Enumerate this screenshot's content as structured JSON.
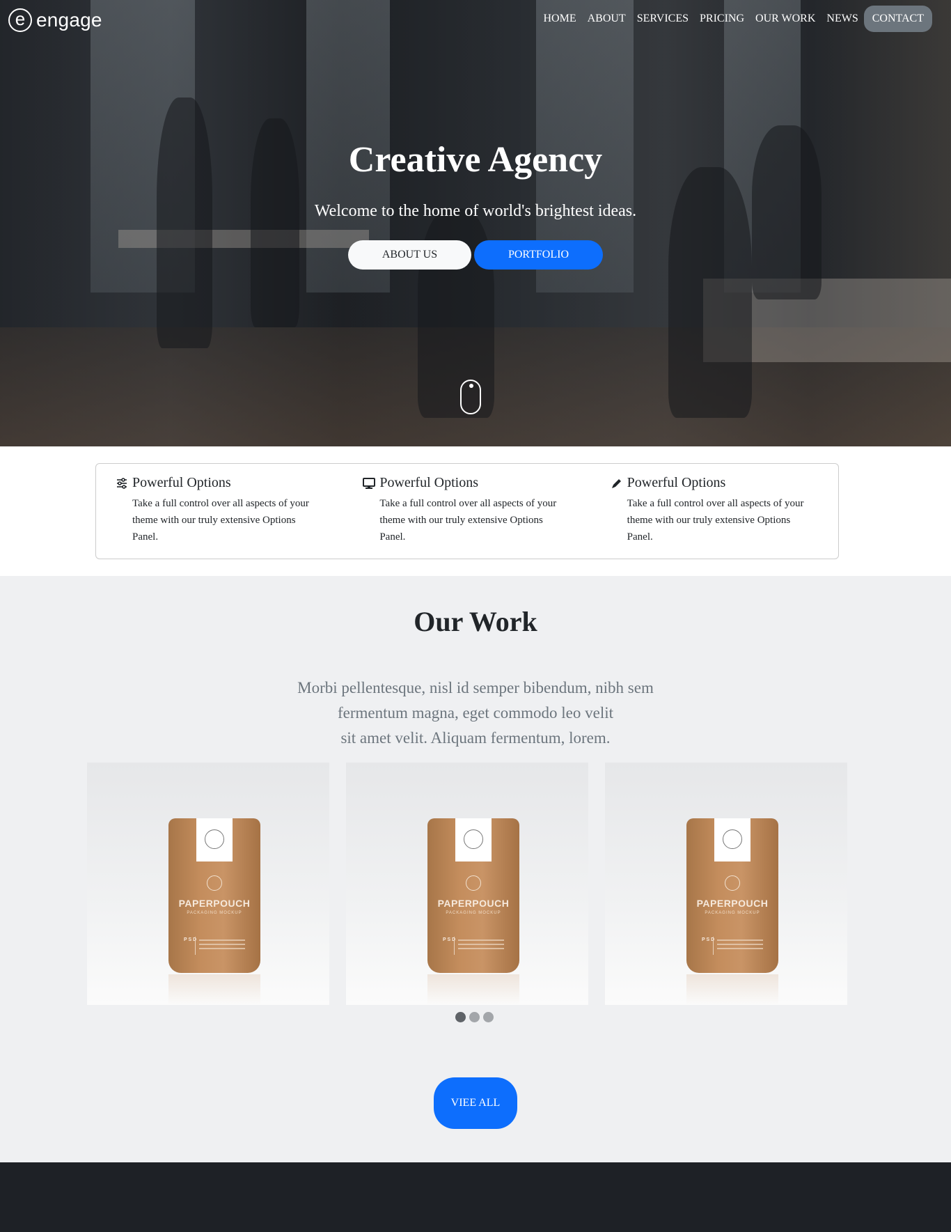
{
  "header": {
    "logo_mark": "e",
    "logo_text": "engage",
    "nav": [
      "HOME",
      "ABOUT",
      "SERVICES",
      "PRICING",
      "OUR WORK",
      "NEWS",
      "CONTACT"
    ]
  },
  "hero": {
    "title": "Creative Agency",
    "subtitle": "Welcome to the home of world's brightest ideas.",
    "about_button": "ABOUT US",
    "portfolio_button": "PORTFOLIO"
  },
  "features": [
    {
      "icon": "sliders-icon",
      "title": "Powerful Options",
      "text": "Take a full control over all aspects of your theme with our truly extensive Options Panel."
    },
    {
      "icon": "monitor-icon",
      "title": "Powerful Options",
      "text": "Take a full control over all aspects of your theme with our truly extensive Options Panel."
    },
    {
      "icon": "pencil-icon",
      "title": "Powerful Options",
      "text": "Take a full control over all aspects of your theme with our truly extensive Options Panel."
    }
  ],
  "work": {
    "title": "Our Work",
    "description": "Morbi pellentesque, nisl id semper bibendum, nibh sem fermentum magna, eget commodo leo velit sit amet velit. Aliquam fermentum, lorem.",
    "desc_lines": [
      "Morbi pellentesque, nisl id semper bibendum, nibh sem",
      "fermentum magna, eget commodo leo velit",
      "sit amet velit. Aliquam fermentum, lorem."
    ],
    "cards": [
      {
        "product": "PAPERPOUCH",
        "sub": "PACKAGING MOCKUP",
        "psd": "P S D"
      },
      {
        "product": "PAPERPOUCH",
        "sub": "PACKAGING MOCKUP",
        "psd": "P S D"
      },
      {
        "product": "PAPERPOUCH",
        "sub": "PACKAGING MOCKUP",
        "psd": "P S D"
      }
    ],
    "carousel_pages": 3,
    "active_page": 1,
    "view_all_button": "VIEE ALL"
  },
  "colors": {
    "primary": "#0d6efd",
    "contact_bg": "#6c757d",
    "section_bg": "#eff0f2",
    "footer_bg": "#1e2126"
  }
}
